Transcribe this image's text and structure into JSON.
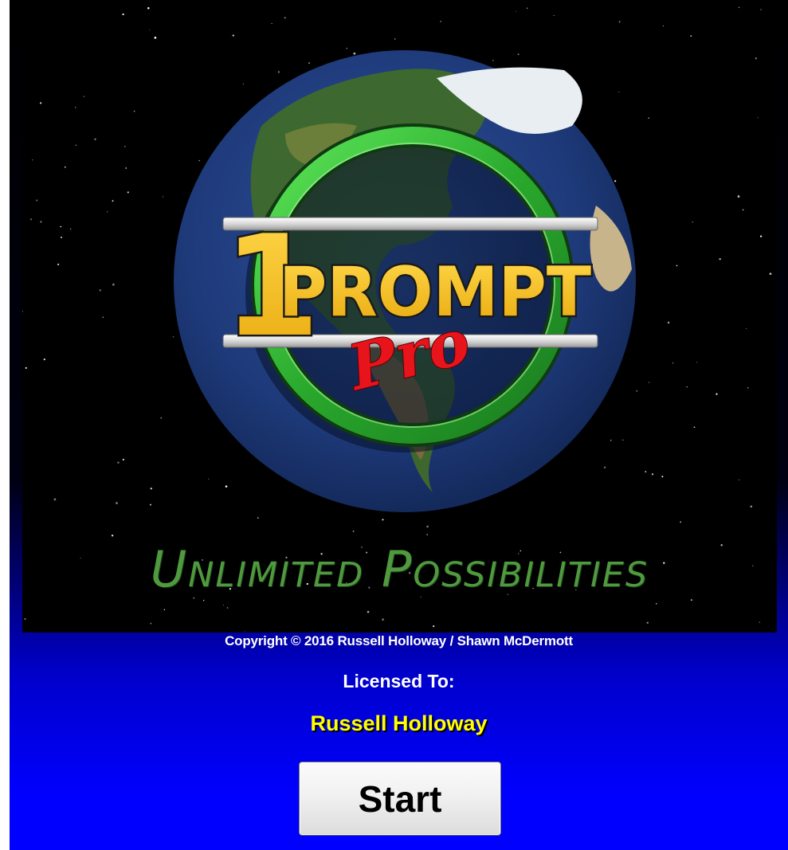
{
  "splash": {
    "logo": {
      "number": "1",
      "word": "PROMPT",
      "suffix": "Pro"
    },
    "tagline": "Unlimited Possibilities"
  },
  "copyright": "Copyright © 2016 Russell Holloway / Shawn McDermott",
  "license": {
    "label": "Licensed To:",
    "name": "Russell Holloway"
  },
  "start_button": {
    "label": "Start"
  },
  "colors": {
    "background_blue": "#0000ff",
    "logo_yellow": "#f5c21b",
    "pro_red": "#e8141c",
    "ring_green": "#35c23a",
    "tagline_green": "#4f9a3e",
    "licensee_yellow": "#ffff00"
  }
}
